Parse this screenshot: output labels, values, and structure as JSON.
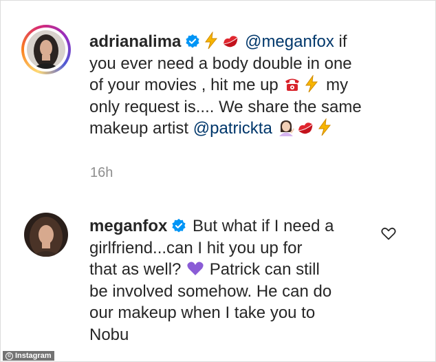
{
  "comments": [
    {
      "username": "adrianalima",
      "verified": true,
      "lines": [
        {
          "pre": "",
          "mention": "@meganfox",
          "post": " if"
        },
        {
          "text": "you ever need a body double in one"
        },
        {
          "pre": "of your movies , hit me up",
          "post": " my"
        },
        {
          "text": "only request is.... We share the same"
        },
        {
          "pre": "makeup artist ",
          "mention": "@patrickta"
        }
      ],
      "time": "16h"
    },
    {
      "username": "meganfox",
      "verified": true,
      "first_text": " But what if I need a",
      "lines": [
        "girlfriend...can I hit you up for",
        "that as well? ",
        " Patrick can still",
        "be involved somehow. He can do",
        "our makeup when I take you to",
        "Nobu"
      ]
    }
  ],
  "icons": {
    "verified": "verified-badge-icon",
    "bolt": "high-voltage-emoji",
    "lips": "kiss-mark-emoji",
    "phone": "telephone-emoji",
    "woman": "woman-tipping-hand-emoji",
    "heart_purple": "purple-heart-emoji",
    "like": "heart-outline-icon"
  },
  "colors": {
    "text": "#262626",
    "mention": "#00376b",
    "timestamp": "#8e8e8e",
    "verified": "#0095f6",
    "purple_heart": "#8a5cd6"
  },
  "credit": "Instagram"
}
